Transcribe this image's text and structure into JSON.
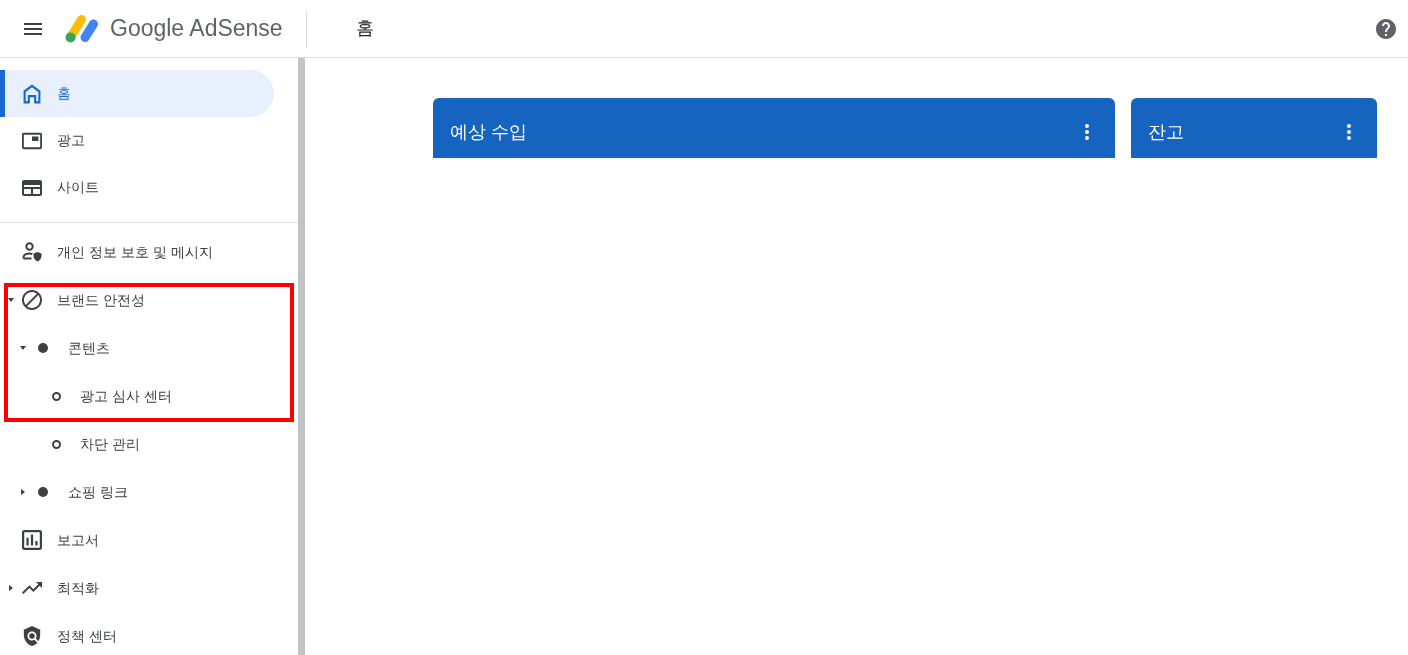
{
  "header": {
    "product_name": "Google AdSense",
    "page_title": "홈"
  },
  "sidebar": {
    "sections": [
      {
        "items": [
          {
            "label": "홈",
            "selected": true,
            "highlighted": false
          },
          {
            "label": "광고",
            "selected": false,
            "highlighted": false
          },
          {
            "label": "사이트",
            "selected": false,
            "highlighted": false
          }
        ]
      },
      {
        "items": [
          {
            "label": "개인 정보 보호 및 메시지",
            "selected": false,
            "highlighted": false
          },
          {
            "label": "브랜드 안전성",
            "selected": false,
            "highlighted": true,
            "expanded": true,
            "children": [
              {
                "label": "콘텐츠",
                "selected": false,
                "highlighted": true,
                "expanded": true,
                "children": [
                  {
                    "label": "광고 심사 센터",
                    "selected": false,
                    "highlighted": true
                  },
                  {
                    "label": "차단 관리",
                    "selected": false,
                    "highlighted": false
                  }
                ]
              },
              {
                "label": "쇼핑 링크",
                "selected": false,
                "highlighted": false,
                "expanded": false
              }
            ]
          },
          {
            "label": "보고서",
            "selected": false,
            "highlighted": false
          },
          {
            "label": "최적화",
            "selected": false,
            "highlighted": false,
            "expanded": false
          },
          {
            "label": "정책 센터",
            "selected": false,
            "highlighted": false
          }
        ]
      }
    ]
  },
  "cards": [
    {
      "title": "예상 수입"
    },
    {
      "title": "잔고"
    }
  ]
}
